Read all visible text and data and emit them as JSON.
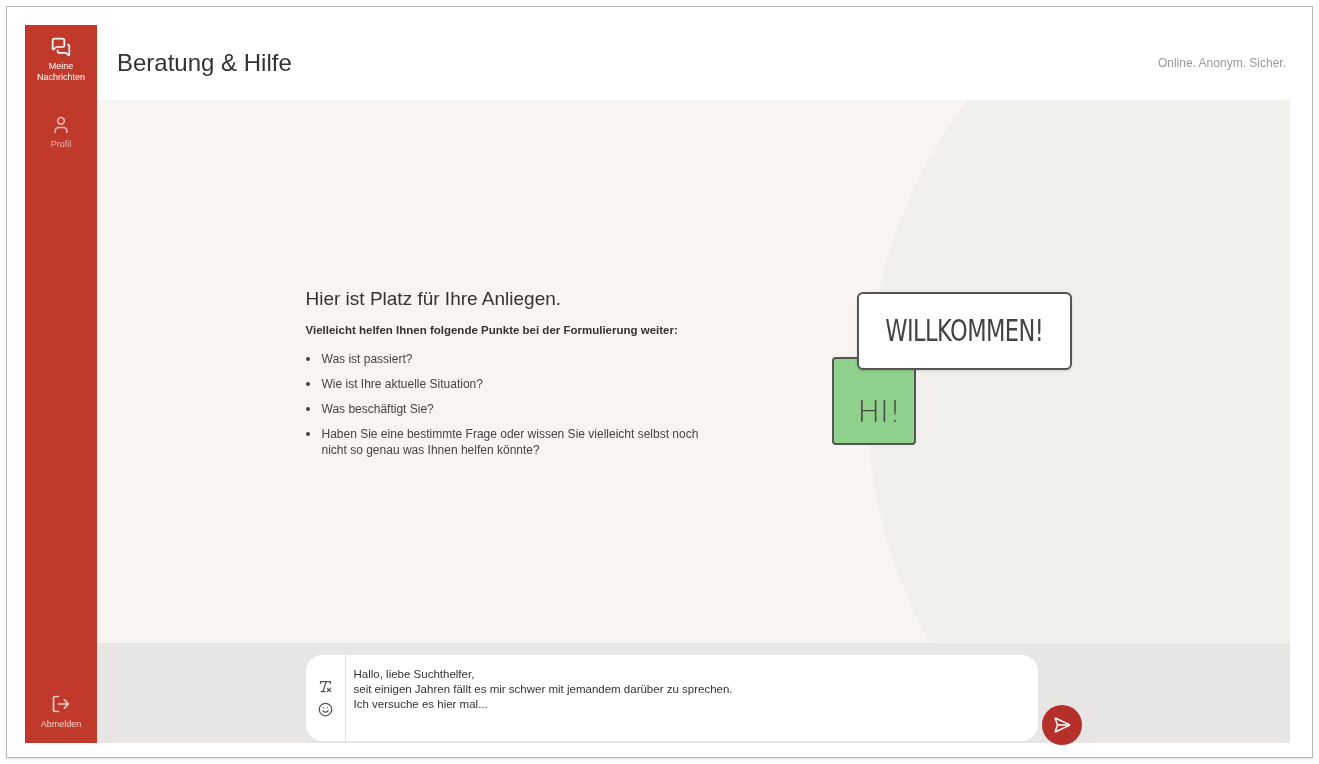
{
  "sidebar": {
    "items": [
      {
        "label": "Meine Nachrichten",
        "kind": "messages",
        "selected": true
      },
      {
        "label": "Profil",
        "kind": "profile",
        "selected": false
      }
    ],
    "logout": {
      "label": "Abmelden"
    }
  },
  "header": {
    "title": "Beratung & Hilfe",
    "tagline": "Online. Anonym. Sicher."
  },
  "welcome": {
    "heading": "Hier ist Platz für Ihre Anliegen.",
    "intro": "Vielleicht helfen Ihnen folgende Punkte bei der Formulierung weiter:",
    "points": [
      "Was ist passiert?",
      "Wie ist Ihre aktuelle Situation?",
      "Was beschäftigt Sie?",
      "Haben Sie eine bestimmte Frage oder wissen Sie vielleicht selbst noch nicht so genau was Ihnen helfen könnte?"
    ],
    "illustration": {
      "big_bubble": "WILLKOMMEN!",
      "small_bubble": "HI!"
    }
  },
  "composer": {
    "value": "Hallo, liebe Suchthelfer,\nseit einigen Jahren fällt es mir schwer mit jemandem darüber zu sprechen.\nIch versuche es hier mal..."
  }
}
